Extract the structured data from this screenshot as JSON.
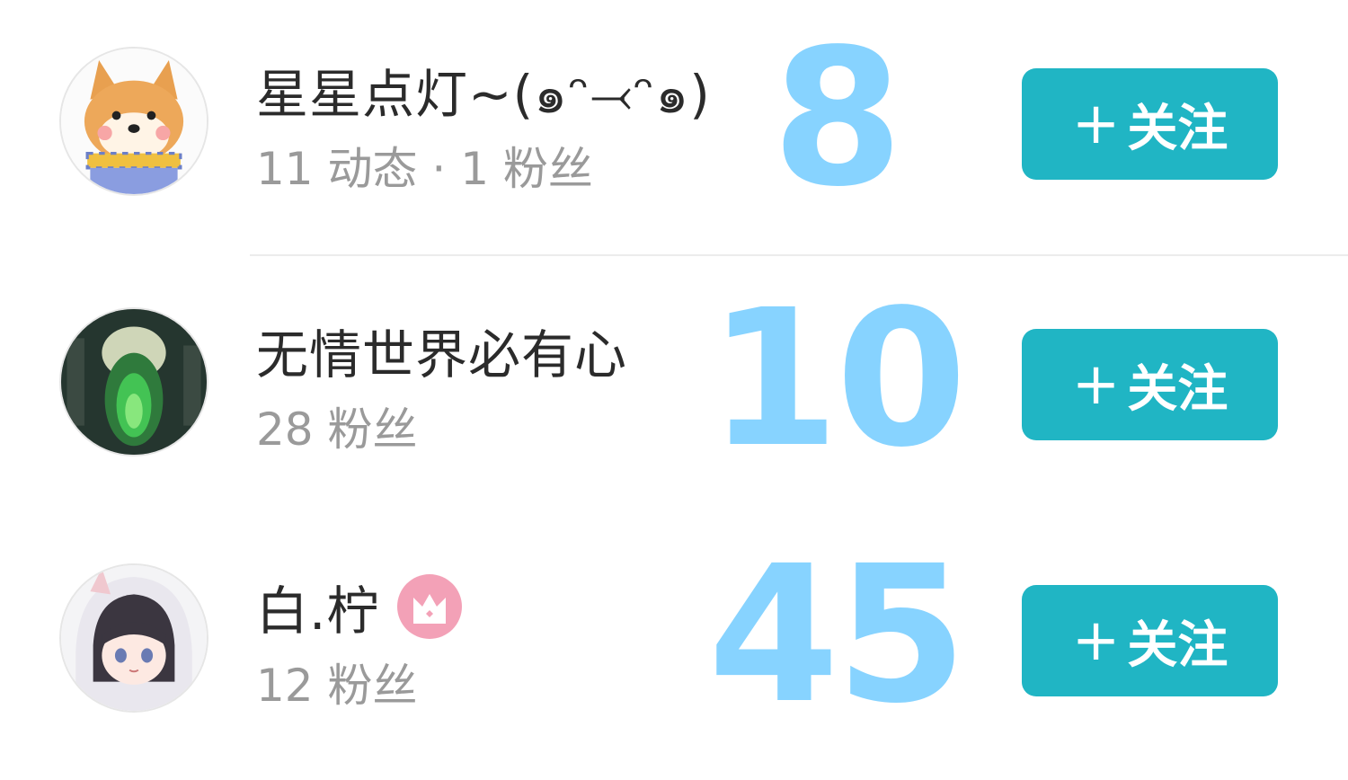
{
  "users": [
    {
      "name": "星星点灯~(๑ᵔ⤙ᵔ๑)",
      "meta": "11 动态 · 1 粉丝",
      "rank": "8",
      "has_crown": false,
      "avatar": "shiba-dog-avatar"
    },
    {
      "name": "无情世界必有心",
      "meta": "28 粉丝",
      "rank": "10",
      "has_crown": false,
      "avatar": "dark-green-character-avatar"
    },
    {
      "name": "白.柠",
      "meta": "12 粉丝",
      "rank": "45",
      "has_crown": true,
      "avatar": "anime-girl-avatar"
    }
  ],
  "follow_button": {
    "plus": "+",
    "label": "关注"
  },
  "colors": {
    "button": "#20b5c4",
    "rank": "#87d3ff",
    "crown": "#f3a1b7"
  }
}
